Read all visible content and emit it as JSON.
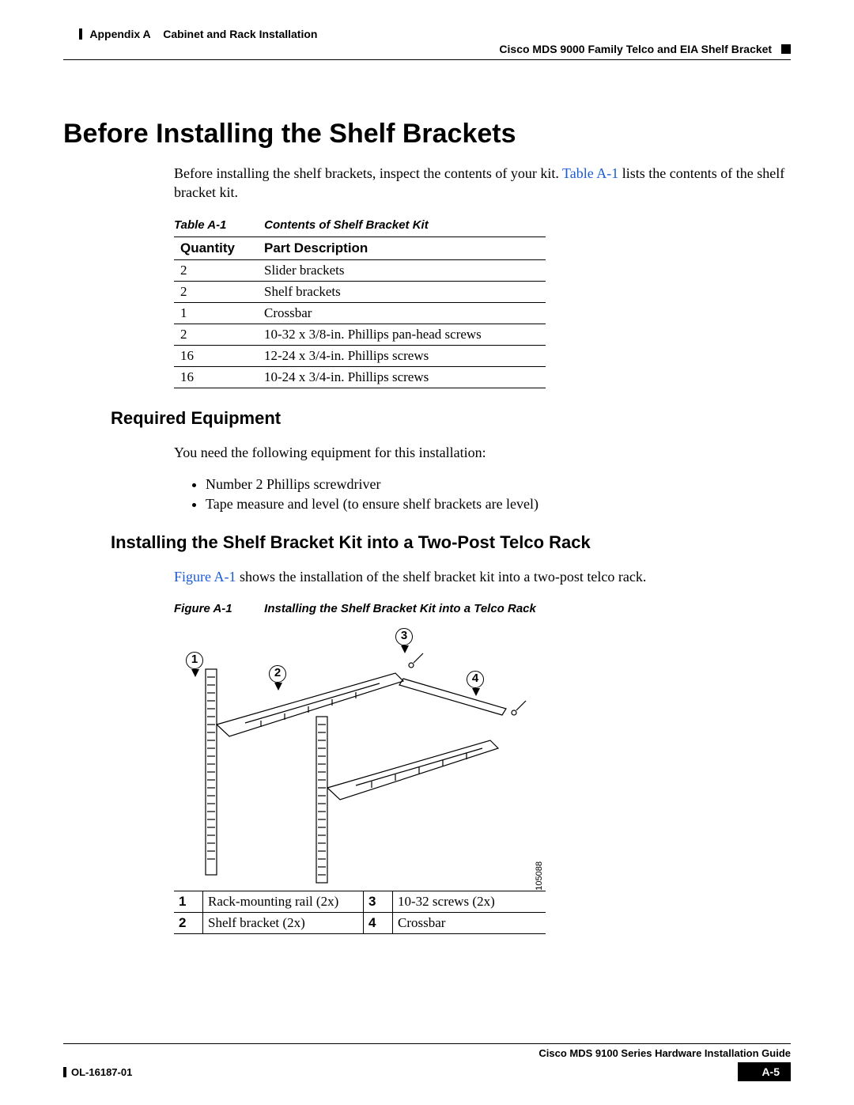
{
  "header": {
    "appendix": "Appendix A",
    "chapter": "Cabinet and Rack Installation",
    "section": "Cisco MDS 9000 Family Telco and EIA Shelf Bracket"
  },
  "h1": "Before Installing the Shelf Brackets",
  "intro_a": "Before installing the shelf brackets, inspect the contents of your kit. ",
  "intro_link": "Table A-1",
  "intro_b": " lists the contents of the shelf bracket kit.",
  "table_caption_num": "Table A-1",
  "table_caption_text": "Contents of Shelf Bracket Kit",
  "table_headers": {
    "qty": "Quantity",
    "desc": "Part Description"
  },
  "kit": [
    {
      "qty": "2",
      "desc": "Slider brackets"
    },
    {
      "qty": "2",
      "desc": "Shelf brackets"
    },
    {
      "qty": "1",
      "desc": "Crossbar"
    },
    {
      "qty": "2",
      "desc": "10-32 x 3/8-in. Phillips pan-head screws"
    },
    {
      "qty": "16",
      "desc": "12-24 x 3/4-in. Phillips screws"
    },
    {
      "qty": "16",
      "desc": "10-24 x 3/4-in. Phillips screws"
    }
  ],
  "h2_equip": "Required Equipment",
  "equip_intro": "You need the following equipment for this installation:",
  "equip": [
    "Number 2 Phillips screwdriver",
    "Tape measure and level (to ensure shelf brackets are level)"
  ],
  "h2_install": "Installing the Shelf Bracket Kit into a Two-Post Telco Rack",
  "install_a": "",
  "install_link": "Figure A-1",
  "install_b": " shows the installation of the shelf bracket kit into a two-post telco rack.",
  "fig_caption_num": "Figure A-1",
  "fig_caption_text": "Installing the Shelf Bracket Kit into a Telco Rack",
  "fig_id": "105088",
  "callouts": {
    "c1": "1",
    "c2": "2",
    "c3": "3",
    "c4": "4"
  },
  "legend": [
    {
      "n1": "1",
      "d1": "Rack-mounting rail (2x)",
      "n2": "3",
      "d2": "10-32 screws (2x)"
    },
    {
      "n1": "2",
      "d1": "Shelf bracket (2x)",
      "n2": "4",
      "d2": "Crossbar"
    }
  ],
  "footer": {
    "title": "Cisco MDS 9100 Series Hardware Installation Guide",
    "doc": "OL-16187-01",
    "page": "A-5"
  }
}
